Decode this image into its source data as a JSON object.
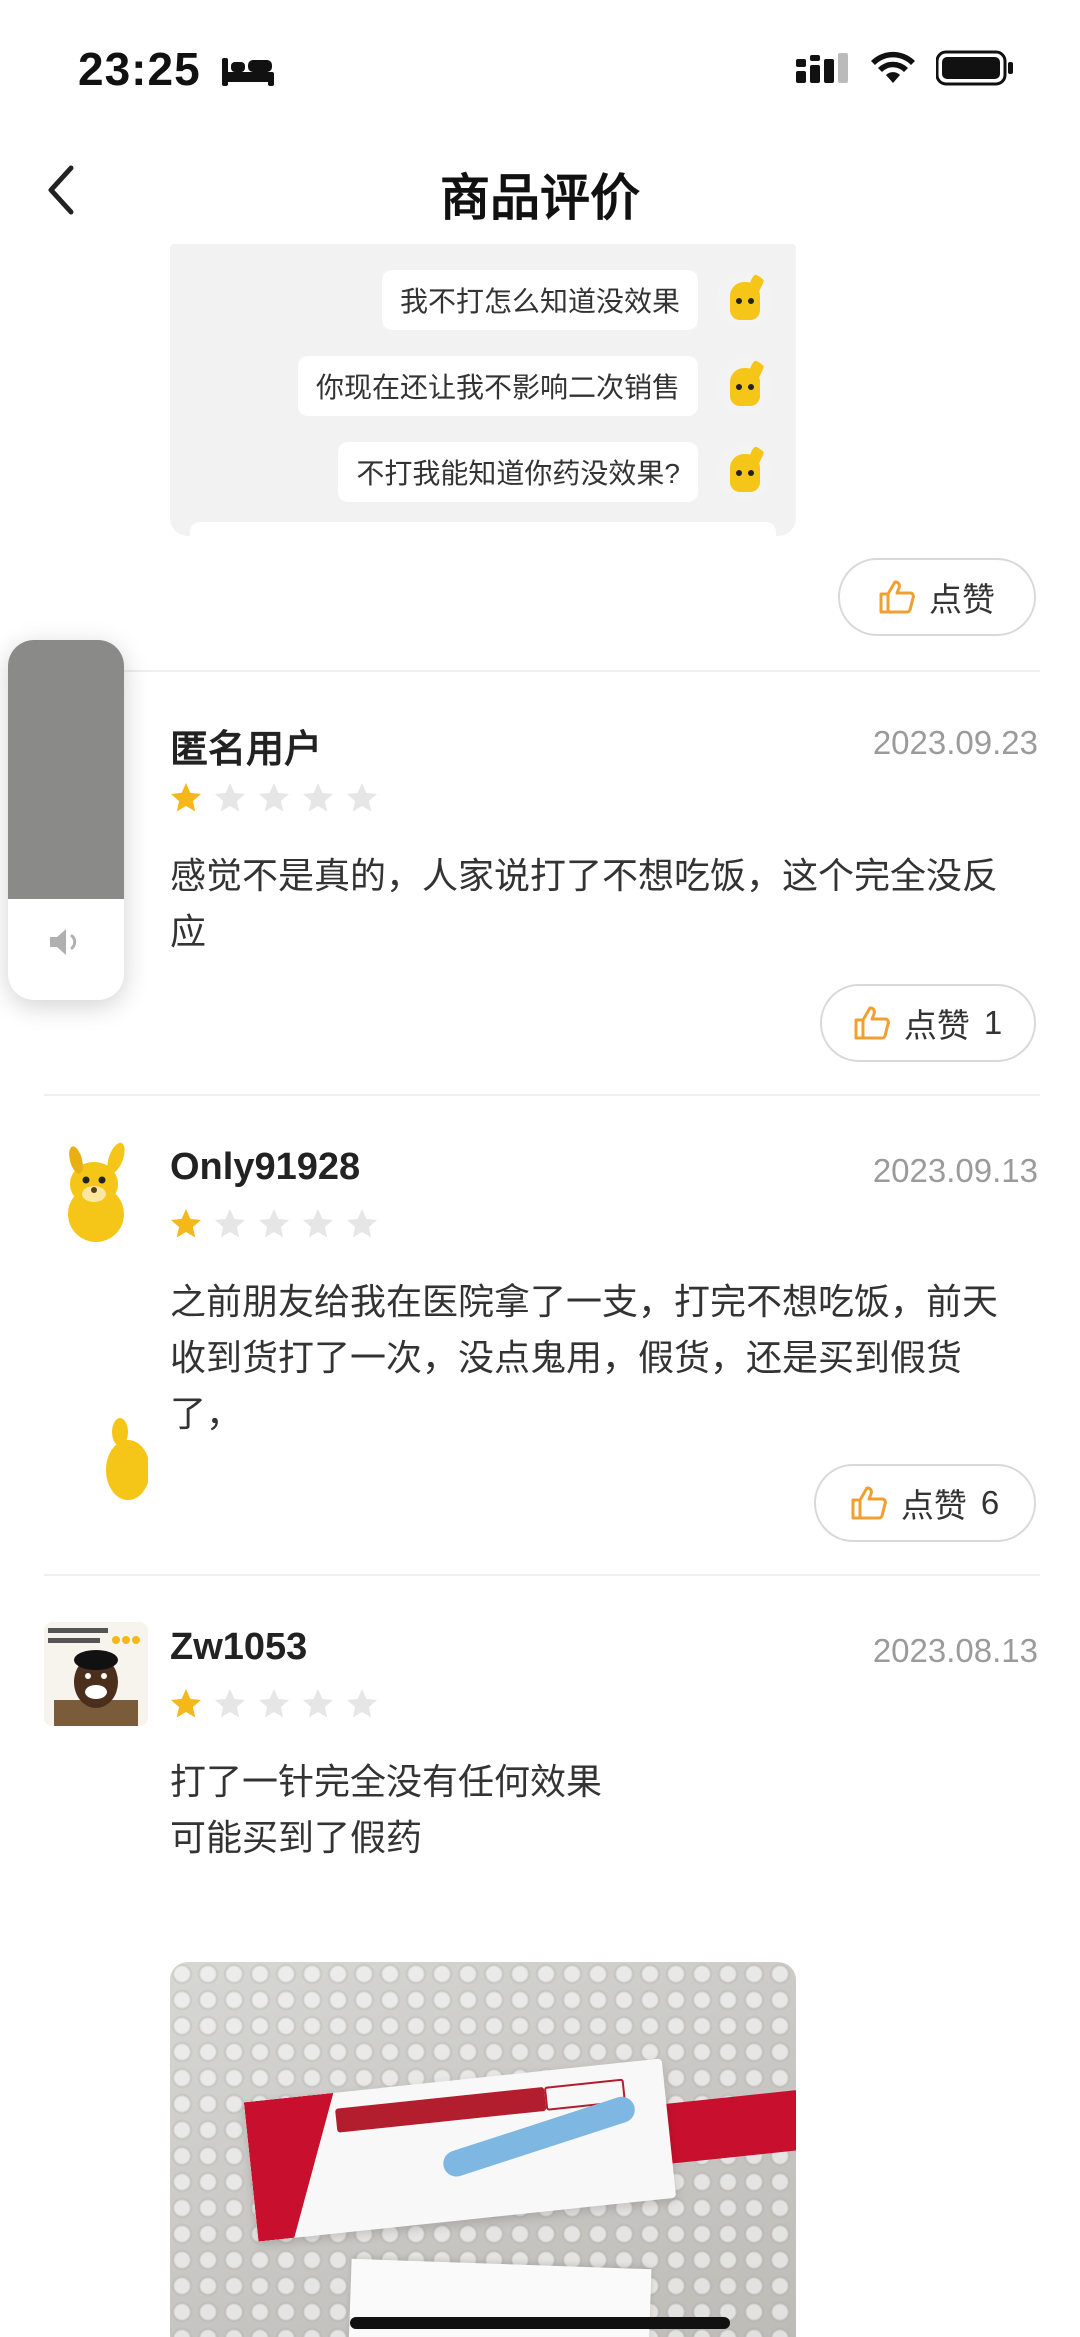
{
  "status_bar": {
    "time": "23:25",
    "icons": [
      "bed-icon",
      "signal-icon",
      "wifi-icon",
      "battery-icon"
    ]
  },
  "nav": {
    "title": "商品评价",
    "back_icon": "chevron-left-icon"
  },
  "chat_image": {
    "messages": [
      "我不打怎么知道没效果",
      "你现在还让我不影响二次销售",
      "不打我能知道你药没效果?"
    ]
  },
  "first_like": {
    "label": "点赞"
  },
  "reviews": [
    {
      "username": "匿名用户",
      "date": "2023.09.23",
      "rating": 1,
      "max_rating": 5,
      "content": "感觉不是真的，人家说打了不想吃饭，这个完全没反应",
      "like_label": "点赞",
      "like_count": "1"
    },
    {
      "username": "Only91928",
      "date": "2023.09.13",
      "rating": 1,
      "max_rating": 5,
      "content": "之前朋友给我在医院拿了一支，打完不想吃饭，前天收到货打了一次，没点鬼用，假货，还是买到假货了，",
      "like_label": "点赞",
      "like_count": "6"
    },
    {
      "username": "Zw1053",
      "date": "2023.08.13",
      "rating": 1,
      "max_rating": 5,
      "content_lines": [
        "打了一针完全没有任何效果",
        "可能买到了假药"
      ]
    }
  ],
  "volume": {
    "level": 0.72,
    "icon": "speaker-icon"
  },
  "colors": {
    "star_active": "#F5B81A",
    "star_inactive": "#E6E6E6",
    "like_icon": "#F0A030",
    "date": "#9B9B9B"
  }
}
